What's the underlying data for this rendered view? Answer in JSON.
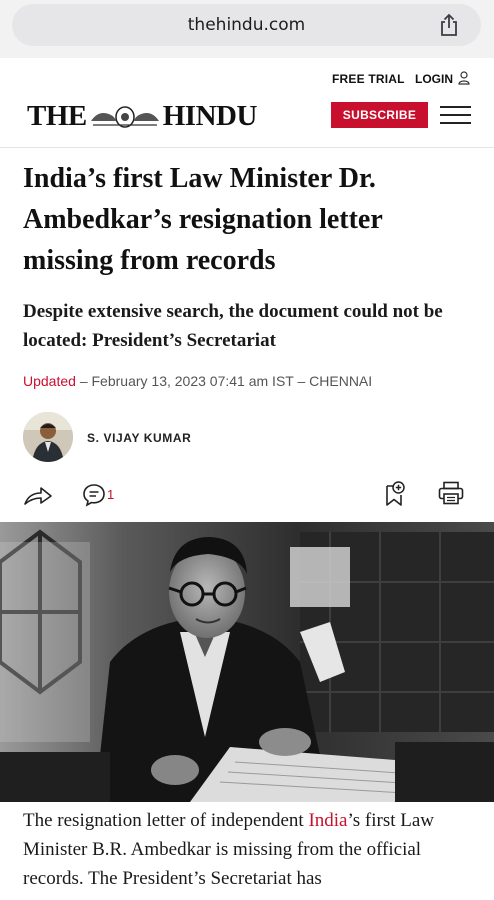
{
  "browser": {
    "url": "thehindu.com",
    "share_icon": "share-icon"
  },
  "header": {
    "free_trial": "FREE TRIAL",
    "login": "LOGIN",
    "masthead_left": "THE",
    "masthead_right": "HINDU",
    "subscribe": "SUBSCRIBE",
    "menu_icon": "hamburger-menu-icon"
  },
  "article": {
    "headline": "India’s first Law Minister Dr. Ambedkar’s resignation letter missing from records",
    "standfirst": "Despite extensive search, the document could not be located: President’s Secretariat",
    "updated_label": "Updated",
    "dateline": " – February 13, 2023 07:41 am IST – CHENNAI",
    "author": "S. VIJAY KUMAR",
    "comment_count": "1",
    "body_before_link": "The resignation letter of independent ",
    "body_link": "India",
    "body_after_link": "’s first Law Minister B.R. Ambedkar is missing from the official records. The President’s Secretariat has"
  },
  "colors": {
    "brand_red": "#c8102e",
    "text": "#111111",
    "meta_grey": "#555555"
  }
}
